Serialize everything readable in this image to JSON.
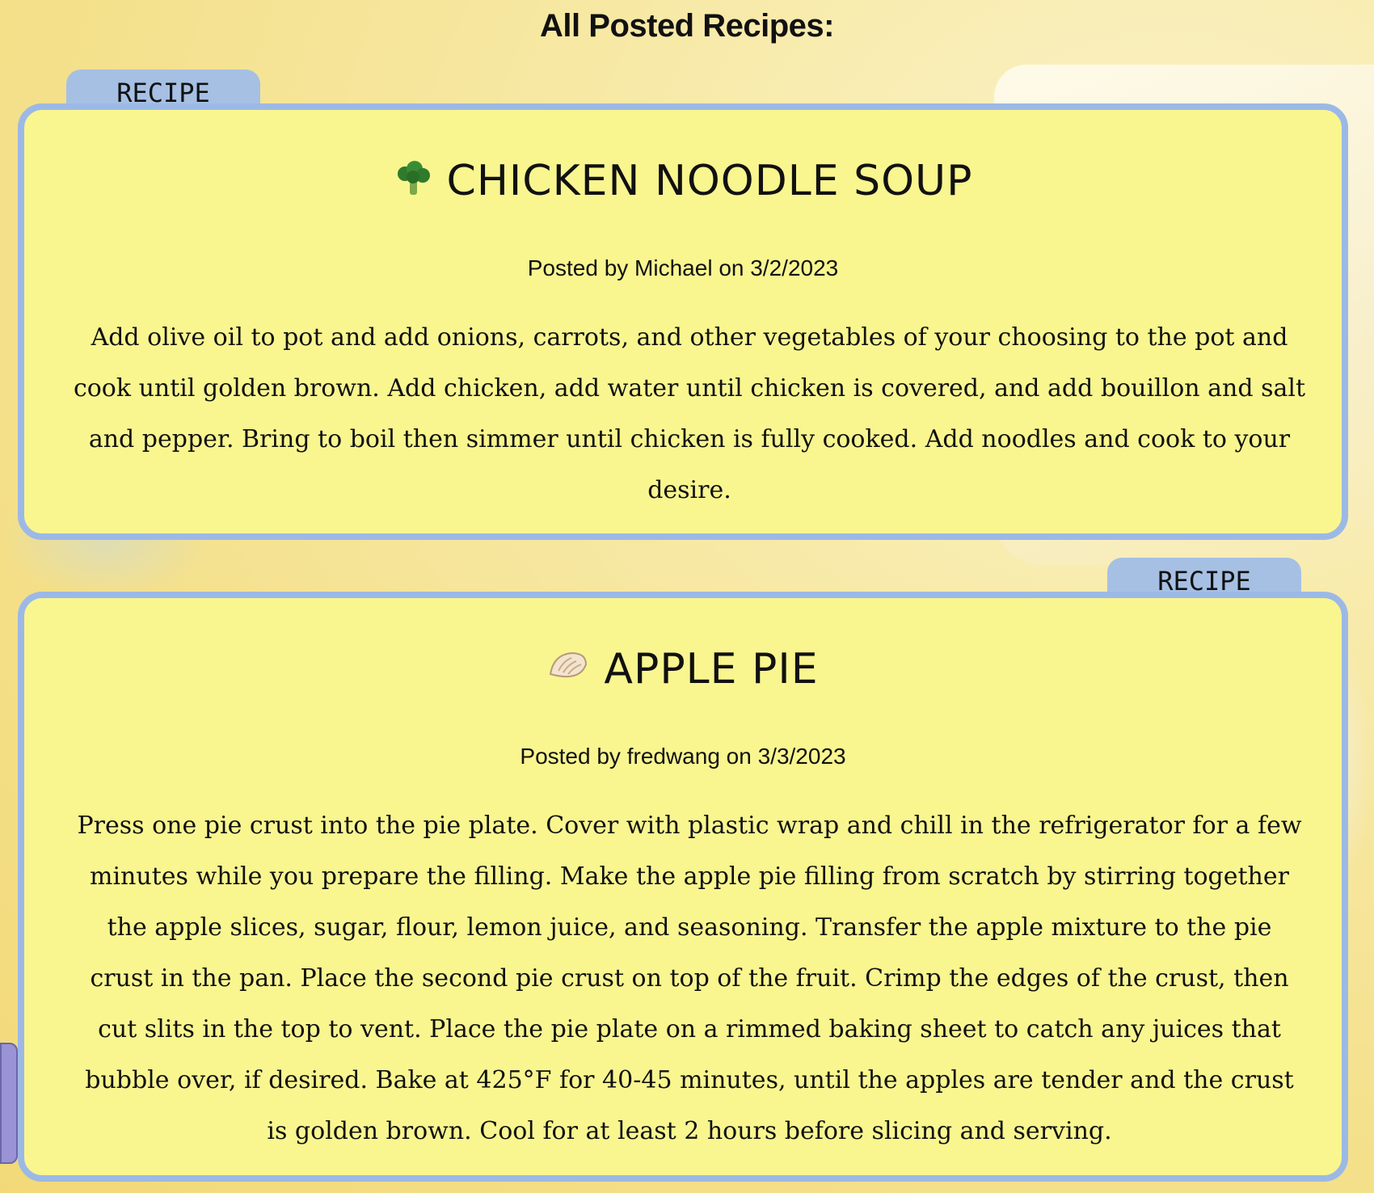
{
  "page": {
    "title": "All Posted Recipes:"
  },
  "recipes": [
    {
      "tab_label": "RECIPE",
      "title": "CHICKEN NOODLE SOUP",
      "icon": "broccoli-icon",
      "author": "Michael",
      "date": "3/2/2023",
      "meta": "Posted by Michael on 3/2/2023",
      "body": "Add olive oil to pot and add onions, carrots, and other vegetables of your choosing to the pot and cook until golden brown. Add chicken, add water until chicken is covered, and add bouillon and salt and pepper. Bring to boil then simmer until chicken is fully cooked. Add noodles and cook to your desire."
    },
    {
      "tab_label": "RECIPE",
      "title": "APPLE PIE",
      "icon": "dumpling-icon",
      "author": "fredwang",
      "date": "3/3/2023",
      "meta": "Posted by fredwang on 3/3/2023",
      "body": "Press one pie crust into the pie plate. Cover with plastic wrap and chill in the refrigerator for a few minutes while you prepare the filling. Make the apple pie filling from scratch by stirring together the apple slices, sugar, flour, lemon juice, and seasoning. Transfer the apple mixture to the pie crust in the pan. Place the second pie crust on top of the fruit. Crimp the edges of the crust, then cut slits in the top to vent. Place the pie plate on a rimmed baking sheet to catch any juices that bubble over, if desired. Bake at 425°F for 40-45 minutes, until the apples are tender and the crust is golden brown. Cool for at least 2 hours before slicing and serving."
    }
  ],
  "colors": {
    "card_bg": "#f9f690",
    "card_border": "#9cb9e6",
    "tab_bg": "#a6c0e4"
  }
}
